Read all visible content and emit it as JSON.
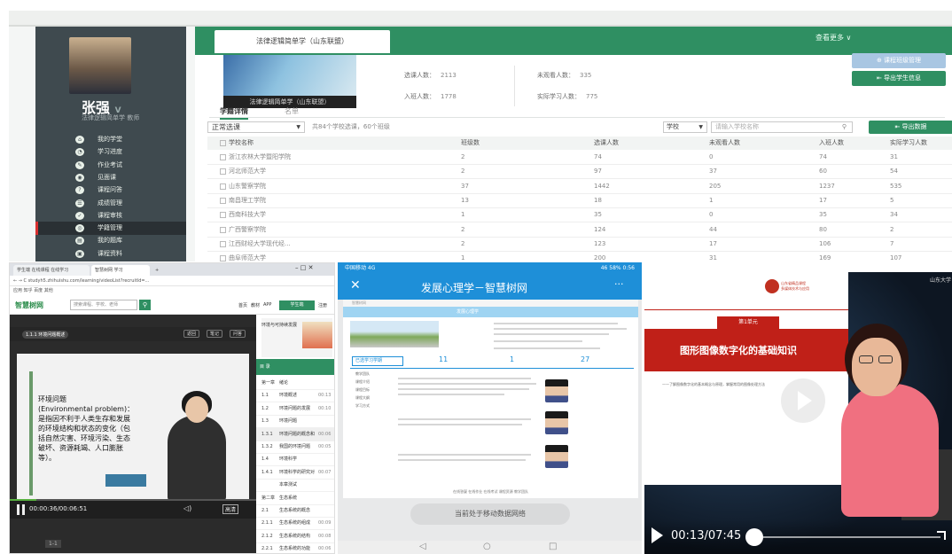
{
  "top": {
    "user_name": "张强",
    "user_suffix": "V",
    "user_role": "法律逻辑简单学 教师",
    "nav": [
      "我的学堂",
      "学习进度",
      "作业考试",
      "见面课",
      "课程问答",
      "成绩管理",
      "课程审核",
      "学籍管理",
      "我的题库",
      "课程资料",
      "招生管理"
    ],
    "active_nav": 7,
    "course_tab": "法律逻辑简单学（山东联盟）",
    "view_more": "查看更多 ∨",
    "course_image_title": "法律逻辑简单学（山东联盟）",
    "stats": {
      "enrolled_label": "选课人数：",
      "enrolled": "2113",
      "not_learned_label": "未观看人数：",
      "not_learned": "335",
      "joined_label": "入班人数：",
      "joined": "1778",
      "actual_label": "实际学习人数：",
      "actual": "775"
    },
    "btn_course_manage": "⊕ 课程班级管理",
    "btn_export_students": "⇤ 导出学生信息",
    "subtab_active": "学籍详情",
    "subtab_other": "名单",
    "filter_value": "正常选课",
    "filter_note": "共84个学校选课，60个班级",
    "search_select": "学校",
    "search_placeholder": "请输入学校名称",
    "export_btn": "导出数据",
    "headers": [
      "学校名称",
      "班级数",
      "选课人数",
      "未观看人数",
      "入班人数",
      "实际学习人数"
    ],
    "rows": [
      [
        "浙江农林大学暨阳学院",
        "2",
        "74",
        "0",
        "74",
        "31"
      ],
      [
        "河北师范大学",
        "2",
        "97",
        "37",
        "60",
        "54"
      ],
      [
        "山东警察学院",
        "37",
        "1442",
        "205",
        "1237",
        "535"
      ],
      [
        "南昌理工学院",
        "13",
        "18",
        "1",
        "17",
        "5"
      ],
      [
        "西南科技大学",
        "1",
        "35",
        "0",
        "35",
        "34"
      ],
      [
        "广西警察学院",
        "2",
        "124",
        "44",
        "80",
        "2"
      ],
      [
        "江西财经大学现代经...",
        "2",
        "123",
        "17",
        "106",
        "7"
      ],
      [
        "曲阜师范大学",
        "1",
        "200",
        "31",
        "169",
        "107"
      ]
    ]
  },
  "bottom_left": {
    "tabs": [
      "学生端 在线课程 在线学习",
      "智慧树网 学习",
      "+"
    ],
    "address": "studyh5.zhihuishu.com/learning/videoList?recruitId=...",
    "bookmarks": "应用  知乎  百度  其他",
    "logo": "智慧树网",
    "search_placeholder": "搜索课程、学校、老师",
    "top_nav": [
      "首页",
      "教材",
      "APP"
    ],
    "green_btn": "学生端",
    "top_nav_last": "注册",
    "pill": "1.1.1 环境问题概述",
    "hd_buttons": [
      "返回",
      "笔记",
      "问答"
    ],
    "video_text": "环境问题\n(Environmental problem)：\n是指因不利于人类生存和发展的环境结构和状态的变化（包括自然灾害、环境污染、生态破坏、资源耗竭、人口膨胀等）。",
    "time": "00:00:36/00:06:51",
    "quality": "高清",
    "sidebar_course": "环境与可持续发展",
    "sidebar_tab": "目 录",
    "chapters": [
      [
        "第一章",
        "绪论",
        ""
      ],
      [
        "1.1",
        "环境概述",
        "00:13"
      ],
      [
        "1.2",
        "环境问题的发展",
        "00:10"
      ],
      [
        "1.3",
        "环境问题",
        ""
      ],
      [
        "1.3.1",
        "环境问题的概念和分类",
        "00:06"
      ],
      [
        "1.3.2",
        "我国的环境问题",
        "00:05"
      ],
      [
        "1.4",
        "环境科学",
        ""
      ],
      [
        "1.4.1",
        "环境科学的研究对象",
        "00:07"
      ],
      [
        "",
        "本章测试",
        ""
      ],
      [
        "第二章",
        "生态系统",
        ""
      ],
      [
        "2.1",
        "生态系统的概念",
        ""
      ],
      [
        "2.1.1",
        "生态系统的组成",
        "00:09"
      ],
      [
        "2.1.2",
        "生态系统的结构",
        "00:08"
      ],
      [
        "2.2.1",
        "生态系统的功能",
        "00:06"
      ]
    ],
    "active_chapter": 4,
    "page_num": "1-1"
  },
  "bottom_middle": {
    "status_left": "中国移动 4G",
    "status_right": "46  58%  0:56",
    "title": "发展心理学－智慧树网",
    "close": "✕",
    "menu": "···",
    "brand": "智慧树网",
    "banner": "发展心理学",
    "select": "已选学习学期",
    "nums": [
      "11",
      "1",
      "27"
    ],
    "left_items": [
      "教学团队",
      "课程介绍",
      "课程目标",
      "课程大纲",
      "学习方式"
    ],
    "footer": "在线答疑  在线作业  在线考试  课程资源  教学团队",
    "offline": "当前处于移动数据网络",
    "nav_buttons": [
      "◁",
      "○",
      "□"
    ]
  },
  "bottom_right": {
    "chapter": "第1单元",
    "title": "图形图像数字化的基础知识",
    "subtitle": "——了解图像数字化的基本概念与原理，掌握常用的图像处理方法",
    "time": "00:13/07:45",
    "brand": "山东大学",
    "header_text": "山东省精品课程\n多媒体技术与应用"
  }
}
